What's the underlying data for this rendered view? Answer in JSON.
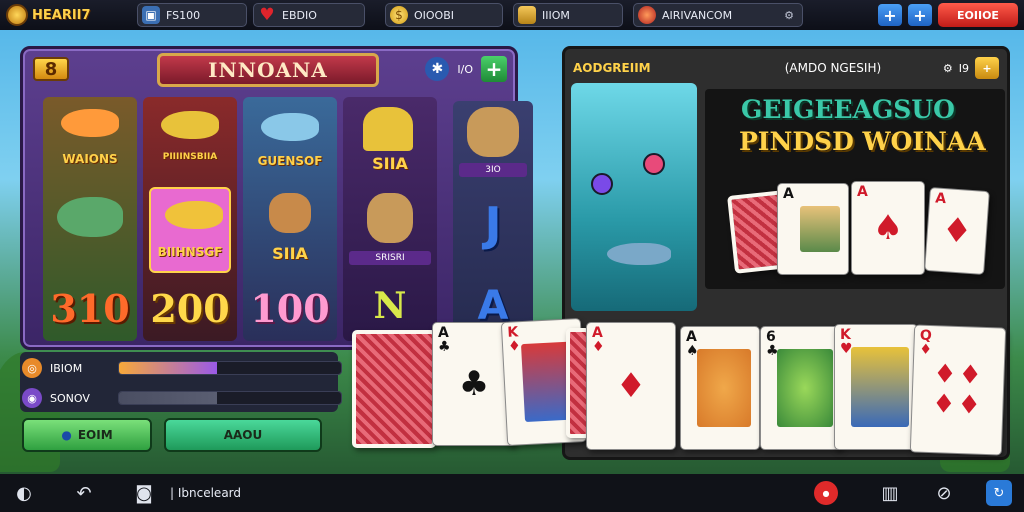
{
  "topbar": {
    "logo_text": "HEARII7",
    "stats": [
      {
        "icon": "chest-icon",
        "value": "FS100"
      },
      {
        "icon": "heart-icon",
        "value": "EBDIO"
      },
      {
        "icon": "coin-icon",
        "value": "OIOOBI"
      },
      {
        "icon": "gold-bars-icon",
        "value": "IIIOM"
      },
      {
        "icon": "avatar-icon",
        "value": "AIRIVANCOM"
      }
    ],
    "red_button": "EOIIOE"
  },
  "slot": {
    "badge": "8",
    "title": "INNOANA",
    "header_count": "I/O",
    "reels": [
      {
        "top_label": "WAIONS",
        "mid_label": "",
        "win": "310"
      },
      {
        "top_label": "PIIIINSBIIA",
        "mid_label": "BIIHNSGF",
        "win": "200"
      },
      {
        "top_label": "GUENSOF",
        "mid_label": "SIIA",
        "win": "100"
      },
      {
        "top_label": "SIIA",
        "mid_label": "",
        "tag": "SRISRI",
        "win": ""
      },
      {
        "top_label": "",
        "tag": "3IO",
        "letters": [
          "J",
          "N",
          "A"
        ]
      }
    ],
    "meters": [
      {
        "label": "IBIOM",
        "fill_fraction": 0.44
      },
      {
        "label": "SONOV",
        "fill_fraction": 0.44
      }
    ],
    "buttons": {
      "left": "EOIM",
      "right": "AAOU"
    }
  },
  "right_panel": {
    "header_left": "AODGREIIM",
    "header_center": "(AMDO NGESIH)",
    "header_count": "I9",
    "promo_line1": "GEIGEEAGSUO",
    "promo_line2": "PINDSD WOINAA"
  },
  "cards": [
    {
      "rank": "",
      "suit": "",
      "back": true
    },
    {
      "rank": "A",
      "suit": "♣",
      "color": "blk"
    },
    {
      "rank": "K",
      "suit": "♦",
      "color": "red",
      "face": true
    },
    {
      "rank": "A",
      "suit": "♦",
      "color": "red"
    },
    {
      "rank": "A",
      "suit": "♠",
      "color": "blk",
      "face": true
    },
    {
      "rank": "6",
      "suit": "♣",
      "color": "blk",
      "face": true
    },
    {
      "rank": "K",
      "suit": "♥",
      "color": "red",
      "face": true
    },
    {
      "rank": "Q",
      "suit": "♦",
      "color": "red"
    }
  ],
  "promo_cards": [
    {
      "rank": "",
      "back": true
    },
    {
      "rank": "A",
      "suit": "♠",
      "color": "blk",
      "face": true
    },
    {
      "rank": "A",
      "suit": "♠",
      "color": "red"
    },
    {
      "rank": "A",
      "suit": "♦",
      "color": "red"
    }
  ],
  "bottombar": {
    "label": "Ibnceleard"
  },
  "colors": {
    "accent_purple": "#5d3f8f",
    "accent_gold": "#ffd24a",
    "danger_red": "#e02a2a"
  }
}
